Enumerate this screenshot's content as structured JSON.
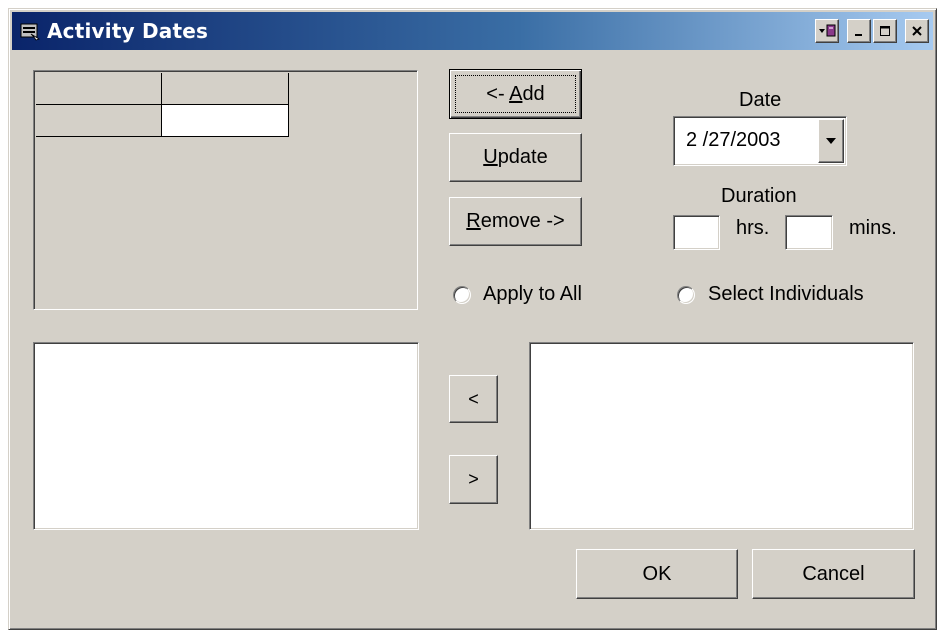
{
  "window": {
    "title": "Activity Dates",
    "controls": {
      "menu_icon": "system-menu-icon",
      "minimize": "_",
      "maximize": "□",
      "close": "✕"
    }
  },
  "grid": {
    "cells": [
      "",
      "",
      "",
      ""
    ]
  },
  "buttons": {
    "add": {
      "prefix": "<- ",
      "access_key": "A",
      "rest": "dd"
    },
    "update": {
      "access_key": "U",
      "rest": "pdate"
    },
    "remove": {
      "access_key": "R",
      "rest": "emove ->"
    },
    "move_left": "<",
    "move_right": ">",
    "ok": "OK",
    "cancel": "Cancel"
  },
  "date": {
    "label": "Date",
    "value": "2 /27/2003"
  },
  "duration": {
    "label": "Duration",
    "hours_value": "",
    "hours_unit": "hrs.",
    "minutes_value": "",
    "minutes_unit": "mins."
  },
  "options": {
    "apply_to_all": "Apply to All",
    "select_individuals": "Select Individuals"
  },
  "lists": {
    "left_items": [],
    "right_items": []
  }
}
